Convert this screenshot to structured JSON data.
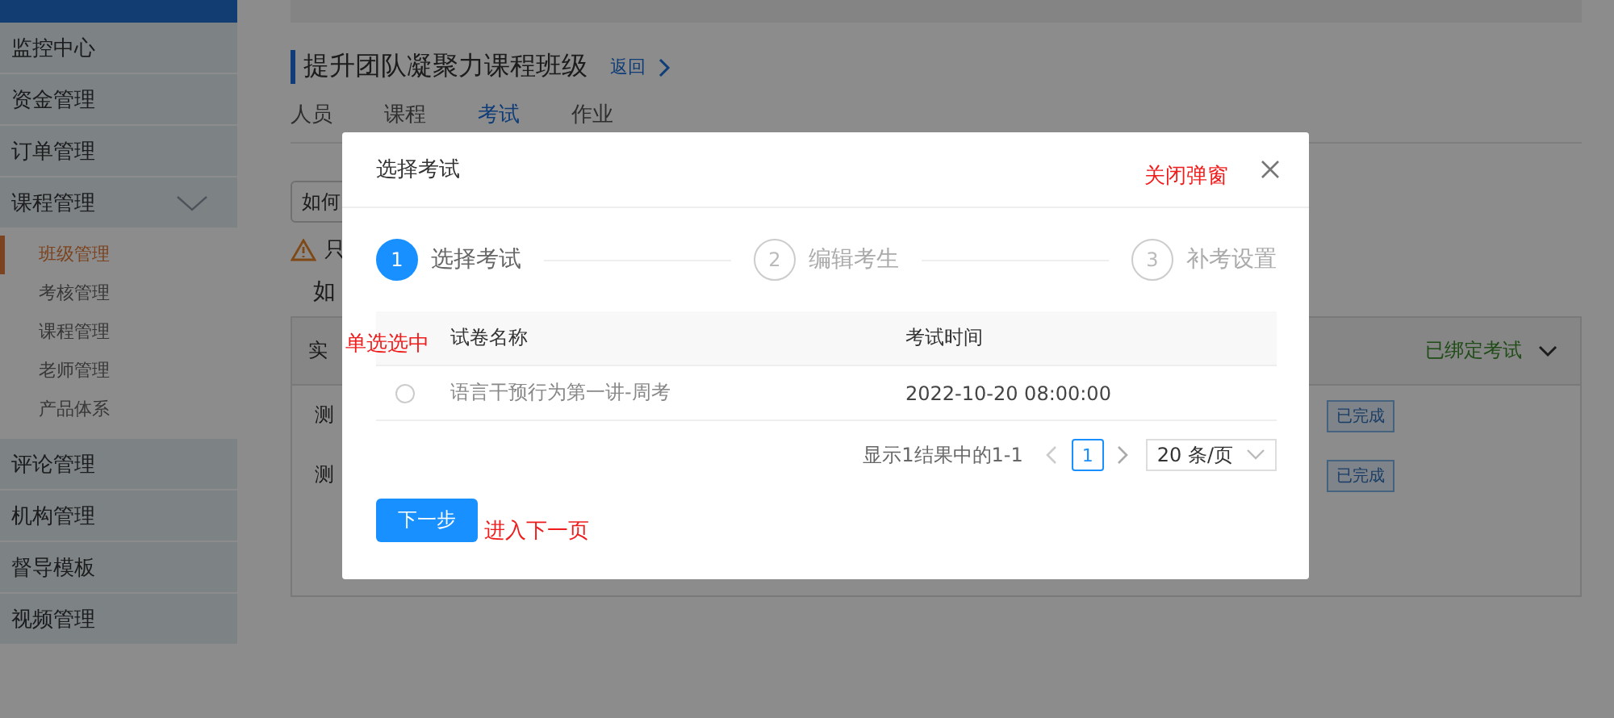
{
  "sidebar": {
    "items": [
      {
        "label": "监控中心"
      },
      {
        "label": "资金管理"
      },
      {
        "label": "订单管理"
      },
      {
        "label": "课程管理",
        "expanded": true,
        "children": [
          {
            "label": "班级管理",
            "selected": true
          },
          {
            "label": "考核管理",
            "selected": false
          },
          {
            "label": "课程管理",
            "selected": false
          },
          {
            "label": "老师管理",
            "selected": false
          },
          {
            "label": "产品体系",
            "selected": false
          }
        ]
      },
      {
        "label": "评论管理"
      },
      {
        "label": "机构管理"
      },
      {
        "label": "督导模板"
      },
      {
        "label": "视频管理"
      }
    ]
  },
  "page": {
    "title": "提升团队凝聚力课程班级",
    "back_link": "返回",
    "tabs": [
      {
        "label": "人员",
        "selected": false
      },
      {
        "label": "课程",
        "selected": false
      },
      {
        "label": "考试",
        "selected": true
      },
      {
        "label": "作业",
        "selected": false
      }
    ],
    "select_value": "如何",
    "warning": "只",
    "subtitle": "如",
    "card": {
      "header": "实",
      "status": "已绑定考试",
      "rows": [
        {
          "name": "测",
          "tag": "已完成"
        },
        {
          "name": "测",
          "tag": "已完成"
        }
      ]
    }
  },
  "modal": {
    "title": "选择考试",
    "close_note": "关闭弹窗",
    "steps": [
      {
        "number": "1",
        "label": "选择考试",
        "selected": true
      },
      {
        "number": "2",
        "label": "编辑考生",
        "selected": false
      },
      {
        "number": "3",
        "label": "补考设置",
        "selected": false
      }
    ],
    "radio_note": "单选选中",
    "columns": [
      "试卷名称",
      "考试时间"
    ],
    "rows": [
      {
        "name": "语言干预行为第一讲-周考",
        "time": "2022-10-20 08:00:00",
        "selected": false
      }
    ],
    "pagination": {
      "summary": "显示1结果中的1-1",
      "current_page": "1",
      "page_size": "20 条/页"
    },
    "next_button": "下一步",
    "next_note": "进入下一页"
  }
}
